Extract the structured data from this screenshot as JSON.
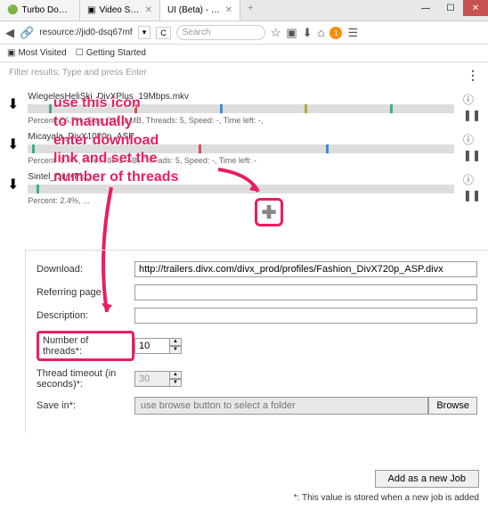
{
  "tabs": [
    {
      "label": "Turbo Downloa...",
      "icon": "🟢"
    },
    {
      "label": "Video Samples ...",
      "icon": "▣"
    },
    {
      "label": "UI (Beta) - T...",
      "icon": ""
    }
  ],
  "address": {
    "url": "resource://jid0-dsq67mf",
    "search_placeholder": "Search"
  },
  "alert_count": "1",
  "bookmarks": [
    {
      "label": "Most Visited"
    },
    {
      "label": "Getting Started"
    }
  ],
  "filter_placeholder": "Filter results; Type and press Enter",
  "downloads": [
    {
      "name": "WiegelesHeliSki_DivXPlus_19Mbps.mkv",
      "stats": "Percent: 26.7%, Size: 366.1 MB, Threads: 5, Speed: -, Time left: -,"
    },
    {
      "name": "Micayala_DivX1080p_ASP...",
      "stats": "Percent: 1.0%, Size: 285.1 MB, Threads: 5, Speed: -, Time left: -"
    },
    {
      "name": "Sintel_DivXPlu...",
      "stats": "Percent: 2.4%, ..."
    }
  ],
  "annotation": {
    "line1": "use this icon",
    "line2": "to manually",
    "line3": "enter download",
    "line4": "link and set the",
    "line5": "number of threads"
  },
  "form": {
    "download_label": "Download:",
    "download_value": "http://trailers.divx.com/divx_prod/profiles/Fashion_DivX720p_ASP.divx",
    "referring_label": "Referring page",
    "description_label": "Description:",
    "threads_label": "Number of threads*:",
    "threads_value": "10",
    "timeout_label": "Thread timeout (in seconds)*:",
    "timeout_value": "30",
    "savein_label": "Save in*:",
    "savein_placeholder": "use browse button to select a folder",
    "browse_label": "Browse",
    "add_job_label": "Add as a new Job",
    "footnote": "*: This value is stored when a new job is added"
  }
}
